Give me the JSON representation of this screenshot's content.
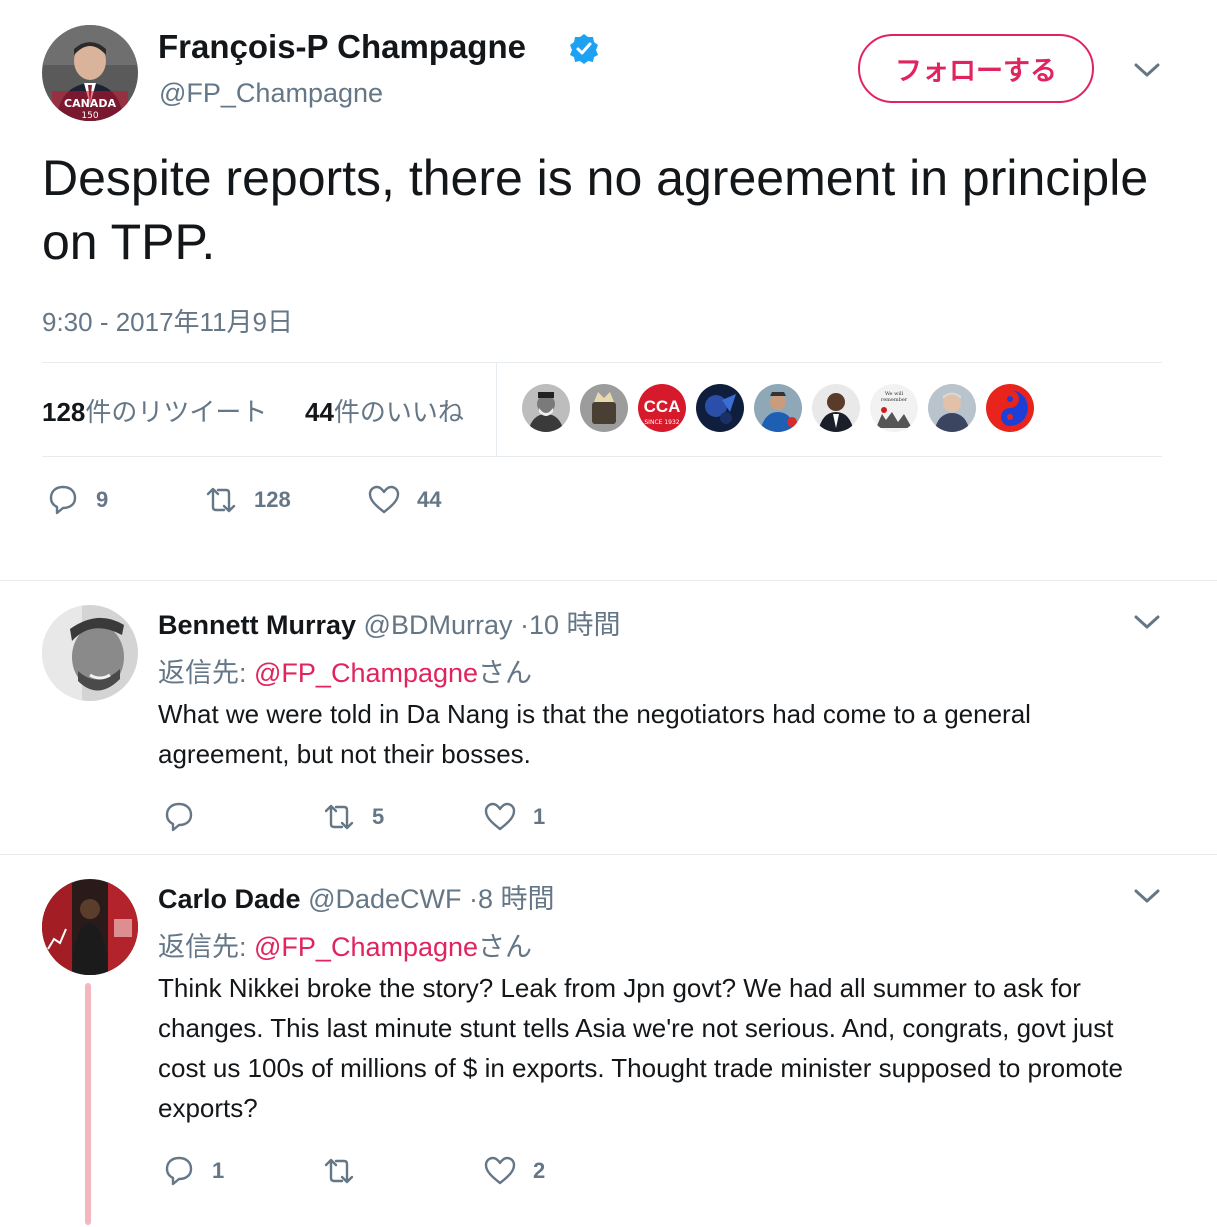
{
  "main_tweet": {
    "author_name": "François-P Champagne",
    "handle": "@FP_Champagne",
    "avatar_icon": "profile-photo-man-suit-canada150",
    "verified_icon": "verified-badge-icon",
    "follow_label": "フォローする",
    "text": "Despite reports, there is no agreement in principle on TPP.",
    "timestamp": "9:30 - 2017年11月9日",
    "retweet_count": "128",
    "retweet_label": "件のリツイート",
    "like_count": "44",
    "like_label": "件のいいね",
    "liker_avatars": [
      "bearded-man",
      "crown-item",
      "cca-since-1932",
      "blue-abstract",
      "man-blue-shirt",
      "man-suit",
      "we-will-remember-them",
      "older-man",
      "red-blue-emblem"
    ],
    "actions": {
      "reply": "9",
      "retweet": "128",
      "like": "44"
    }
  },
  "replies": [
    {
      "author_name": "Bennett Murray",
      "handle": "@BDMurray",
      "time": "·10 時間",
      "reply_to_prefix": "返信先: ",
      "reply_to_mention": "@FP_Champagne",
      "reply_to_suffix": "さん",
      "text": "What we were told in Da Nang is that the negotiators had come to a general agreement, but not their bosses.",
      "actions": {
        "reply": "",
        "retweet": "5",
        "like": "1"
      }
    },
    {
      "author_name": "Carlo Dade",
      "handle": "@DadeCWF",
      "time": "·8 時間",
      "reply_to_prefix": "返信先: ",
      "reply_to_mention": "@FP_Champagne",
      "reply_to_suffix": "さん",
      "text": "Think Nikkei broke the story? Leak from Jpn govt? We had all summer to ask for changes. This last minute stunt tells Asia we're not serious. And, congrats, govt just cost us 100s of millions of $ in exports. Thought trade minister supposed to promote exports?",
      "actions": {
        "reply": "1",
        "retweet": "",
        "like": "2"
      }
    }
  ],
  "colors": {
    "accent": "#e0245e",
    "text": "#14171a",
    "secondary": "#657786",
    "border": "#e6ecf0",
    "verified": "#1da1f2",
    "thread_line": "#f4b6bf"
  }
}
